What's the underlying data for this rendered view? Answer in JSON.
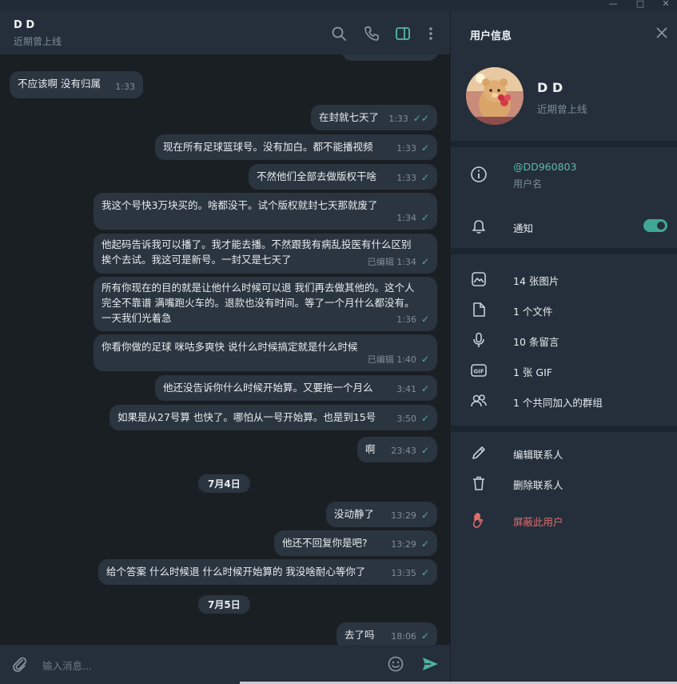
{
  "window": {
    "controls": [
      "—",
      "□",
      "✕"
    ]
  },
  "chat": {
    "name": "D D",
    "status": "近期曾上线",
    "messages": [
      {
        "text": "不应该啊 没有归属",
        "time": "1:33",
        "dir": "in"
      },
      {
        "text": "在封就七天了",
        "time": "1:33",
        "dir": "out",
        "read": true
      },
      {
        "text": "现在所有足球篮球号。没有加白。都不能播视频",
        "time": "1:33",
        "dir": "out"
      },
      {
        "text": "不然他们全部去做版权干啥",
        "time": "1:33",
        "dir": "out"
      },
      {
        "text": "我这个号快3万块买的。啥都没干。试个版权就封七天那就废了",
        "time": "1:34",
        "dir": "out"
      },
      {
        "line1": "他起码告诉我可以播了。我才能去播。不然跟我有病乱投医有什么区别",
        "line2": "挨个去试。我这可是新号。一封又是七天了",
        "time": "已编辑 1:34",
        "dir": "out"
      },
      {
        "line1": "所有你现在的目的就是让他什么时候可以退 我们再去做其他的。这个人",
        "line2": "完全不靠谱 满嘴跑火车的。退款也没有时间。等了一个月什么都没有。",
        "line3": "一天我们光着急",
        "time": "1:36",
        "dir": "out"
      },
      {
        "text": "你看你做的足球 咪咕多爽快 说什么时候搞定就是什么时候",
        "time": "已编辑 1:40",
        "dir": "out"
      },
      {
        "text": "他还没告诉你什么时候开始算。又要拖一个月么",
        "time": "3:41",
        "dir": "out"
      },
      {
        "text": "如果是从27号算 也快了。哪怕从一号开始算。也是到15号",
        "time": "3:50",
        "dir": "out"
      },
      {
        "text": "啊",
        "time": "23:43",
        "dir": "out"
      },
      {
        "text": "没动静了",
        "time": "13:29",
        "dir": "out"
      },
      {
        "text": "他还不回复你是吧?",
        "time": "13:29",
        "dir": "out"
      },
      {
        "text": "给个答案 什么时候退 什么时候开始算的 我没啥耐心等你了",
        "time": "13:35",
        "dir": "out"
      },
      {
        "text": "去了吗",
        "time": "18:06",
        "dir": "out"
      }
    ],
    "date_separators": [
      "7月4日",
      "7月5日"
    ],
    "composer_placeholder": "输入消息..."
  },
  "info": {
    "title": "用户信息",
    "name": "D D",
    "status": "近期曾上线",
    "username": "@DD960803",
    "username_label": "用户名",
    "notifications_label": "通知",
    "notifications_on": true,
    "media": [
      {
        "icon": "photo-icon",
        "label": "14 张图片"
      },
      {
        "icon": "file-icon",
        "label": "1 个文件"
      },
      {
        "icon": "microphone-icon",
        "label": "10 条留言"
      },
      {
        "icon": "gif-icon",
        "label": "1 张 GIF"
      },
      {
        "icon": "group-icon",
        "label": "1 个共同加入的群组"
      }
    ],
    "actions": {
      "edit": "编辑联系人",
      "delete": "删除联系人",
      "block": "屏蔽此用户"
    }
  },
  "colors": {
    "accent": "#40a796",
    "danger": "#e36b6b",
    "panel": "#242f3b",
    "bubble": "#2b3540"
  }
}
